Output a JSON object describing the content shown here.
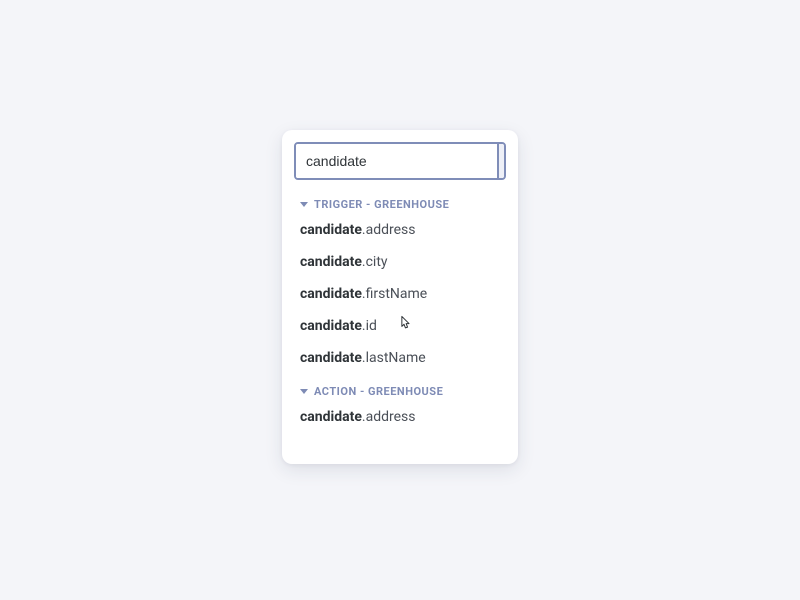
{
  "search": {
    "value": "candidate",
    "placeholder": ""
  },
  "groups": [
    {
      "label": "TRIGGER - GREENHOUSE",
      "items": [
        {
          "strong": "candidate",
          "rest": ".address"
        },
        {
          "strong": "candidate",
          "rest": ".city"
        },
        {
          "strong": "candidate",
          "rest": ".firstName"
        },
        {
          "strong": "candidate",
          "rest": ".id"
        },
        {
          "strong": "candidate",
          "rest": ".lastName"
        }
      ]
    },
    {
      "label": "ACTION - GREENHOUSE",
      "items": [
        {
          "strong": "candidate",
          "rest": ".address"
        }
      ]
    }
  ]
}
